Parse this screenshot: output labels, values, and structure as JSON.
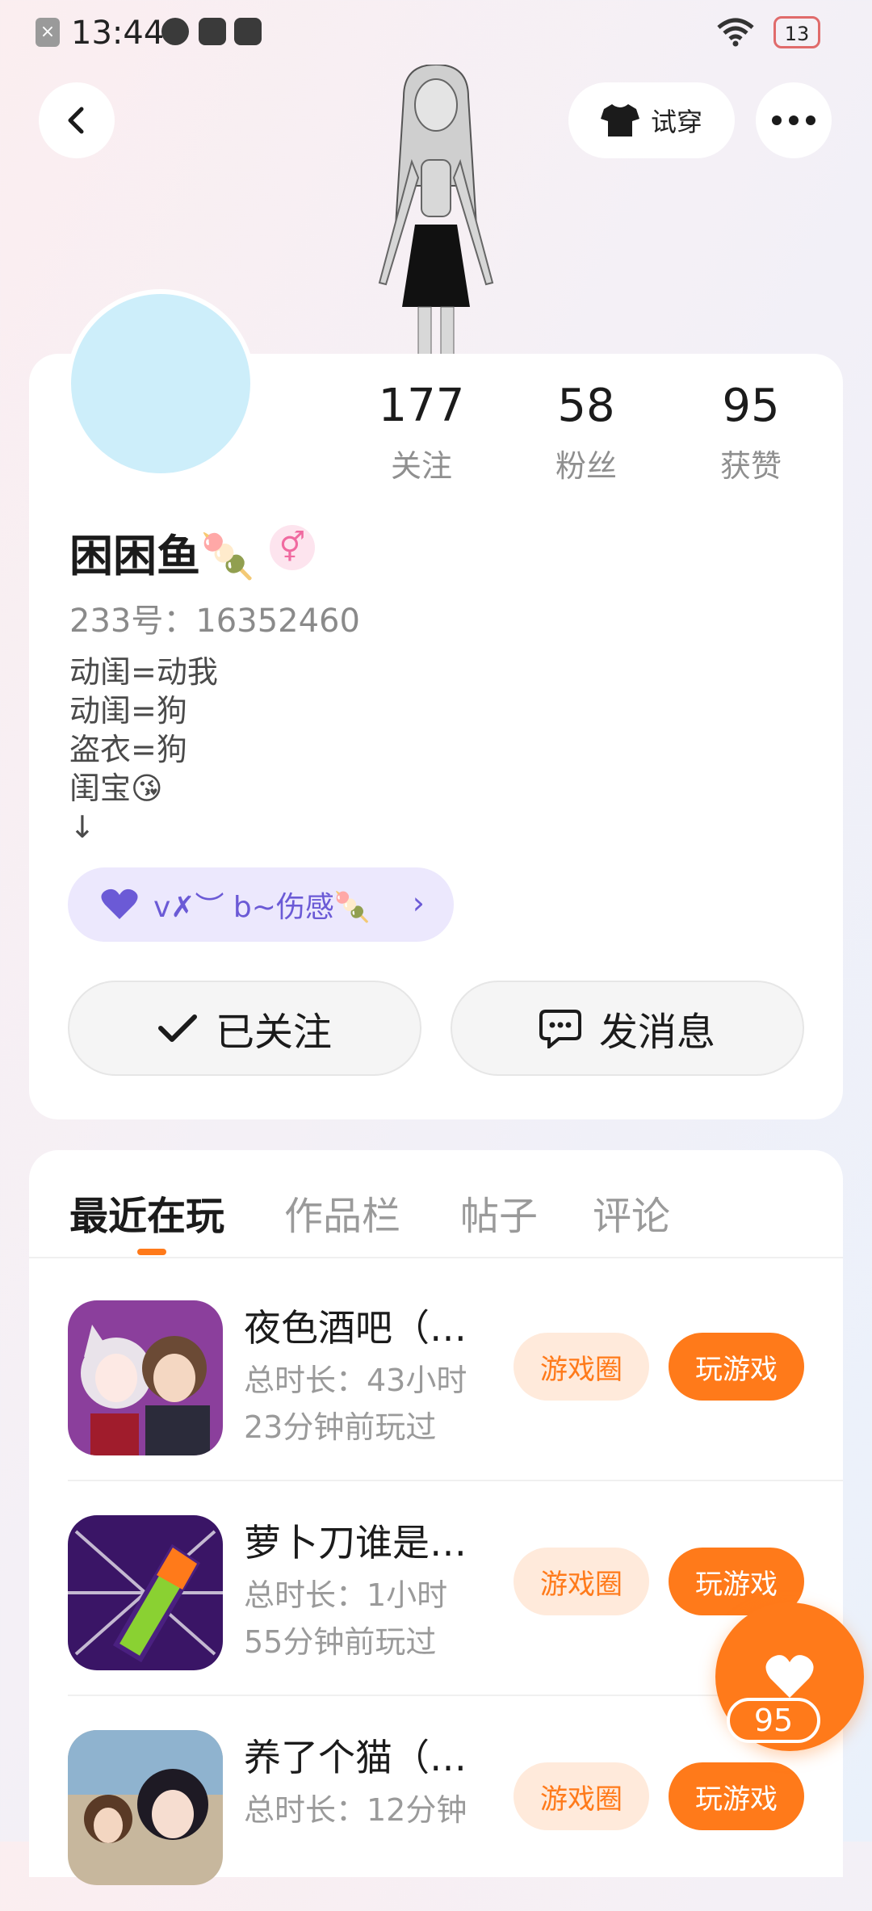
{
  "status_bar": {
    "time": "13:44",
    "battery": "13"
  },
  "top_bar": {
    "tryon_label": "试穿"
  },
  "profile": {
    "stats": [
      {
        "value": "177",
        "label": "关注"
      },
      {
        "value": "58",
        "label": "粉丝"
      },
      {
        "value": "95",
        "label": "获赞"
      }
    ],
    "nickname": "困困鱼",
    "nickname_emoji": "🍡",
    "gender_symbol": "⚥",
    "id_line": "233号：16352460",
    "bio_lines": [
      "动闺=动我",
      "动闺=狗",
      "盗衣=狗",
      "闺宝😘",
      "↓"
    ],
    "tag": {
      "text": "v✗︶ b~伤感🍡",
      "icon": "heart-icon"
    },
    "follow_button": "已关注",
    "message_button": "发消息"
  },
  "tabs": [
    {
      "label": "最近在玩",
      "active": true
    },
    {
      "label": "作品栏",
      "active": false
    },
    {
      "label": "帖子",
      "active": false
    },
    {
      "label": "评论",
      "active": false
    }
  ],
  "games": [
    {
      "title": "夜色酒吧（…",
      "duration": "总时长：43小时",
      "last_played": "23分钟前玩过",
      "circle_label": "游戏圈",
      "play_label": "玩游戏"
    },
    {
      "title": "萝卜刀谁是…",
      "duration": "总时长：1小时",
      "last_played": "55分钟前玩过",
      "circle_label": "游戏圈",
      "play_label": "玩游戏"
    },
    {
      "title": "养了个猫（…",
      "duration": "总时长：12分钟",
      "last_played": "",
      "circle_label": "游戏圈",
      "play_label": "玩游戏"
    }
  ],
  "like_fab": {
    "count": "95"
  },
  "colors": {
    "accent": "#ff7a1a",
    "accent_light": "#ffeadb",
    "tag_bg": "#ece8fd",
    "tag_text": "#6b5ad6"
  }
}
